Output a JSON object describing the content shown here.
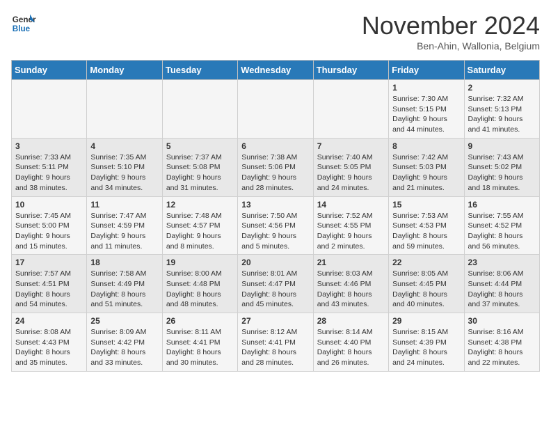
{
  "logo": {
    "line1": "General",
    "line2": "Blue"
  },
  "header": {
    "title": "November 2024",
    "location": "Ben-Ahin, Wallonia, Belgium"
  },
  "columns": [
    "Sunday",
    "Monday",
    "Tuesday",
    "Wednesday",
    "Thursday",
    "Friday",
    "Saturday"
  ],
  "weeks": [
    [
      {
        "day": "",
        "info": ""
      },
      {
        "day": "",
        "info": ""
      },
      {
        "day": "",
        "info": ""
      },
      {
        "day": "",
        "info": ""
      },
      {
        "day": "",
        "info": ""
      },
      {
        "day": "1",
        "info": "Sunrise: 7:30 AM\nSunset: 5:15 PM\nDaylight: 9 hours\nand 44 minutes."
      },
      {
        "day": "2",
        "info": "Sunrise: 7:32 AM\nSunset: 5:13 PM\nDaylight: 9 hours\nand 41 minutes."
      }
    ],
    [
      {
        "day": "3",
        "info": "Sunrise: 7:33 AM\nSunset: 5:11 PM\nDaylight: 9 hours\nand 38 minutes."
      },
      {
        "day": "4",
        "info": "Sunrise: 7:35 AM\nSunset: 5:10 PM\nDaylight: 9 hours\nand 34 minutes."
      },
      {
        "day": "5",
        "info": "Sunrise: 7:37 AM\nSunset: 5:08 PM\nDaylight: 9 hours\nand 31 minutes."
      },
      {
        "day": "6",
        "info": "Sunrise: 7:38 AM\nSunset: 5:06 PM\nDaylight: 9 hours\nand 28 minutes."
      },
      {
        "day": "7",
        "info": "Sunrise: 7:40 AM\nSunset: 5:05 PM\nDaylight: 9 hours\nand 24 minutes."
      },
      {
        "day": "8",
        "info": "Sunrise: 7:42 AM\nSunset: 5:03 PM\nDaylight: 9 hours\nand 21 minutes."
      },
      {
        "day": "9",
        "info": "Sunrise: 7:43 AM\nSunset: 5:02 PM\nDaylight: 9 hours\nand 18 minutes."
      }
    ],
    [
      {
        "day": "10",
        "info": "Sunrise: 7:45 AM\nSunset: 5:00 PM\nDaylight: 9 hours\nand 15 minutes."
      },
      {
        "day": "11",
        "info": "Sunrise: 7:47 AM\nSunset: 4:59 PM\nDaylight: 9 hours\nand 11 minutes."
      },
      {
        "day": "12",
        "info": "Sunrise: 7:48 AM\nSunset: 4:57 PM\nDaylight: 9 hours\nand 8 minutes."
      },
      {
        "day": "13",
        "info": "Sunrise: 7:50 AM\nSunset: 4:56 PM\nDaylight: 9 hours\nand 5 minutes."
      },
      {
        "day": "14",
        "info": "Sunrise: 7:52 AM\nSunset: 4:55 PM\nDaylight: 9 hours\nand 2 minutes."
      },
      {
        "day": "15",
        "info": "Sunrise: 7:53 AM\nSunset: 4:53 PM\nDaylight: 8 hours\nand 59 minutes."
      },
      {
        "day": "16",
        "info": "Sunrise: 7:55 AM\nSunset: 4:52 PM\nDaylight: 8 hours\nand 56 minutes."
      }
    ],
    [
      {
        "day": "17",
        "info": "Sunrise: 7:57 AM\nSunset: 4:51 PM\nDaylight: 8 hours\nand 54 minutes."
      },
      {
        "day": "18",
        "info": "Sunrise: 7:58 AM\nSunset: 4:49 PM\nDaylight: 8 hours\nand 51 minutes."
      },
      {
        "day": "19",
        "info": "Sunrise: 8:00 AM\nSunset: 4:48 PM\nDaylight: 8 hours\nand 48 minutes."
      },
      {
        "day": "20",
        "info": "Sunrise: 8:01 AM\nSunset: 4:47 PM\nDaylight: 8 hours\nand 45 minutes."
      },
      {
        "day": "21",
        "info": "Sunrise: 8:03 AM\nSunset: 4:46 PM\nDaylight: 8 hours\nand 43 minutes."
      },
      {
        "day": "22",
        "info": "Sunrise: 8:05 AM\nSunset: 4:45 PM\nDaylight: 8 hours\nand 40 minutes."
      },
      {
        "day": "23",
        "info": "Sunrise: 8:06 AM\nSunset: 4:44 PM\nDaylight: 8 hours\nand 37 minutes."
      }
    ],
    [
      {
        "day": "24",
        "info": "Sunrise: 8:08 AM\nSunset: 4:43 PM\nDaylight: 8 hours\nand 35 minutes."
      },
      {
        "day": "25",
        "info": "Sunrise: 8:09 AM\nSunset: 4:42 PM\nDaylight: 8 hours\nand 33 minutes."
      },
      {
        "day": "26",
        "info": "Sunrise: 8:11 AM\nSunset: 4:41 PM\nDaylight: 8 hours\nand 30 minutes."
      },
      {
        "day": "27",
        "info": "Sunrise: 8:12 AM\nSunset: 4:41 PM\nDaylight: 8 hours\nand 28 minutes."
      },
      {
        "day": "28",
        "info": "Sunrise: 8:14 AM\nSunset: 4:40 PM\nDaylight: 8 hours\nand 26 minutes."
      },
      {
        "day": "29",
        "info": "Sunrise: 8:15 AM\nSunset: 4:39 PM\nDaylight: 8 hours\nand 24 minutes."
      },
      {
        "day": "30",
        "info": "Sunrise: 8:16 AM\nSunset: 4:38 PM\nDaylight: 8 hours\nand 22 minutes."
      }
    ]
  ]
}
